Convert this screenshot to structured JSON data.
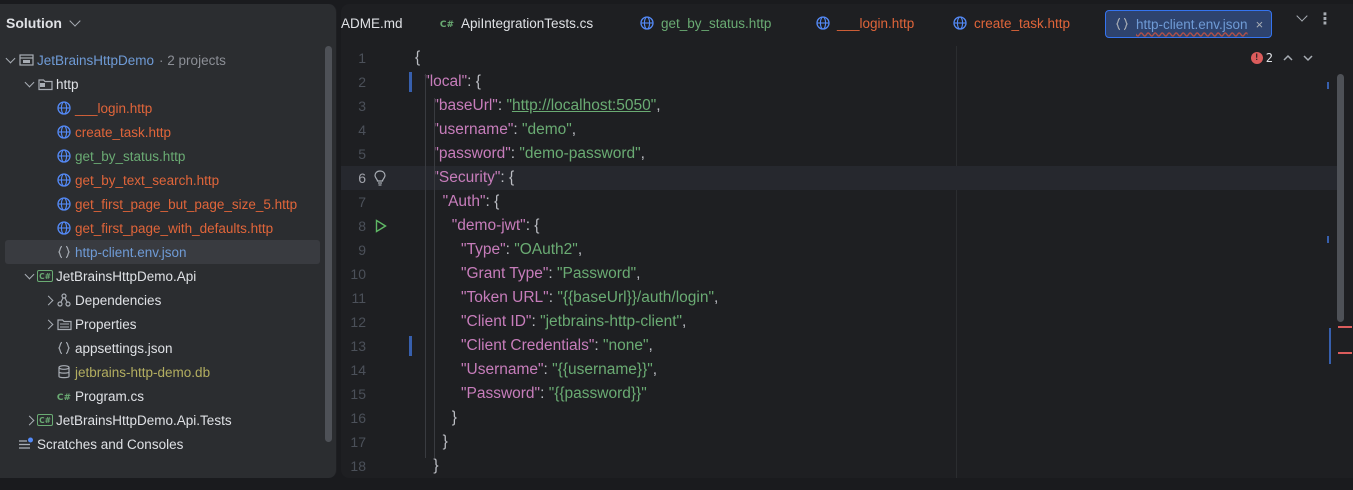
{
  "solution_panel": {
    "title": "Solution",
    "tree": [
      {
        "label": "JetBrainsHttpDemo",
        "suffix": "· 2 projects",
        "icon": "solution-icon",
        "color": "c-blue",
        "indent": 0,
        "arrow": "down"
      },
      {
        "label": "http",
        "icon": "folder-icon",
        "color": "c-white",
        "indent": 1,
        "arrow": "down"
      },
      {
        "label": "___login.http",
        "icon": "globe-icon",
        "color": "c-red",
        "indent": 2,
        "arrow": ""
      },
      {
        "label": "create_task.http",
        "icon": "globe-icon",
        "color": "c-red",
        "indent": 2,
        "arrow": ""
      },
      {
        "label": "get_by_status.http",
        "icon": "globe-icon",
        "color": "c-green",
        "indent": 2,
        "arrow": ""
      },
      {
        "label": "get_by_text_search.http",
        "icon": "globe-icon",
        "color": "c-red",
        "indent": 2,
        "arrow": ""
      },
      {
        "label": "get_first_page_but_page_size_5.http",
        "icon": "globe-icon",
        "color": "c-red",
        "indent": 2,
        "arrow": ""
      },
      {
        "label": "get_first_page_with_defaults.http",
        "icon": "globe-icon",
        "color": "c-red",
        "indent": 2,
        "arrow": ""
      },
      {
        "label": "http-client.env.json",
        "icon": "json-icon",
        "color": "c-blue",
        "indent": 2,
        "arrow": "",
        "selected": true
      },
      {
        "label": "JetBrainsHttpDemo.Api",
        "icon": "csharp-project-icon",
        "color": "c-white",
        "indent": 1,
        "arrow": "down"
      },
      {
        "label": "Dependencies",
        "icon": "dependencies-icon",
        "color": "c-white",
        "indent": 2,
        "arrow": "right"
      },
      {
        "label": "Properties",
        "icon": "properties-folder-icon",
        "color": "c-white",
        "indent": 2,
        "arrow": "right"
      },
      {
        "label": "appsettings.json",
        "icon": "json-icon",
        "color": "c-white",
        "indent": 2,
        "arrow": ""
      },
      {
        "label": "jetbrains-http-demo.db",
        "icon": "database-icon",
        "color": "c-yellow",
        "indent": 2,
        "arrow": ""
      },
      {
        "label": "Program.cs",
        "icon": "csharp-file-icon",
        "color": "c-white",
        "indent": 2,
        "arrow": ""
      },
      {
        "label": "JetBrainsHttpDemo.Api.Tests",
        "icon": "csharp-project-icon",
        "color": "c-white",
        "indent": 1,
        "arrow": "right"
      },
      {
        "label": "Scratches and Consoles",
        "icon": "scratches-icon",
        "color": "c-white",
        "indent": 0,
        "arrow": ""
      }
    ]
  },
  "tabs": [
    {
      "label": "ADME.md",
      "icon": "",
      "color": "c-white",
      "active": false
    },
    {
      "label": "ApiIntegrationTests.cs",
      "icon": "csharp-file-icon",
      "color": "c-white",
      "active": false
    },
    {
      "label": "get_by_status.http",
      "icon": "globe-icon",
      "color": "c-green",
      "active": false
    },
    {
      "label": "___login.http",
      "icon": "globe-icon",
      "color": "c-red",
      "active": false
    },
    {
      "label": "create_task.http",
      "icon": "globe-icon",
      "color": "c-red",
      "active": false
    },
    {
      "label": "http-client.env.json",
      "icon": "json-icon",
      "color": "c-blue",
      "active": true
    }
  ],
  "tab_close": "×",
  "tab_more": "⋮",
  "error_count": "2",
  "error_symbol": "!",
  "current_line": 6,
  "code_lines": [
    {
      "n": "1",
      "indent": 0,
      "tokens": [
        [
          "p",
          "{"
        ]
      ]
    },
    {
      "n": "2",
      "indent": 1,
      "tokens": [
        [
          "k",
          "\"local\""
        ],
        [
          "p",
          ": {"
        ]
      ]
    },
    {
      "n": "3",
      "indent": 2,
      "tokens": [
        [
          "k",
          "\"baseUrl\""
        ],
        [
          "p",
          ": "
        ],
        [
          "s",
          "\""
        ],
        [
          "u",
          "http://localhost:5050"
        ],
        [
          "s",
          "\""
        ],
        [
          "p",
          ","
        ]
      ]
    },
    {
      "n": "4",
      "indent": 2,
      "tokens": [
        [
          "k",
          "\"username\""
        ],
        [
          "p",
          ": "
        ],
        [
          "s",
          "\"demo\""
        ],
        [
          "p",
          ","
        ]
      ]
    },
    {
      "n": "5",
      "indent": 2,
      "tokens": [
        [
          "k",
          "\"password\""
        ],
        [
          "p",
          ": "
        ],
        [
          "s",
          "\"demo-password\""
        ],
        [
          "p",
          ","
        ]
      ]
    },
    {
      "n": "6",
      "indent": 2,
      "tokens": [
        [
          "k",
          "\"Security\""
        ],
        [
          "p",
          ": {"
        ]
      ]
    },
    {
      "n": "7",
      "indent": 3,
      "tokens": [
        [
          "k",
          "\"Auth\""
        ],
        [
          "p",
          ": {"
        ]
      ]
    },
    {
      "n": "8",
      "indent": 4,
      "tokens": [
        [
          "k",
          "\"demo-jwt\""
        ],
        [
          "p",
          ": {"
        ]
      ]
    },
    {
      "n": "9",
      "indent": 5,
      "tokens": [
        [
          "k",
          "\"Type\""
        ],
        [
          "p",
          ": "
        ],
        [
          "s",
          "\"OAuth2\""
        ],
        [
          "p",
          ","
        ]
      ]
    },
    {
      "n": "10",
      "indent": 5,
      "tokens": [
        [
          "k",
          "\"Grant Type\""
        ],
        [
          "p",
          ": "
        ],
        [
          "s",
          "\"Password\""
        ],
        [
          "p",
          ","
        ]
      ]
    },
    {
      "n": "11",
      "indent": 5,
      "tokens": [
        [
          "k",
          "\"Token URL\""
        ],
        [
          "p",
          ": "
        ],
        [
          "s",
          "\"{{baseUrl}}/auth/login\""
        ],
        [
          "p",
          ","
        ]
      ]
    },
    {
      "n": "12",
      "indent": 5,
      "tokens": [
        [
          "k",
          "\"Client ID\""
        ],
        [
          "p",
          ": "
        ],
        [
          "s",
          "\"jetbrains-http-client\""
        ],
        [
          "p",
          ","
        ]
      ]
    },
    {
      "n": "13",
      "indent": 5,
      "tokens": [
        [
          "k",
          "\"Client Credentials\""
        ],
        [
          "p",
          ": "
        ],
        [
          "s",
          "\"none\""
        ],
        [
          "p",
          ","
        ]
      ]
    },
    {
      "n": "14",
      "indent": 5,
      "tokens": [
        [
          "k",
          "\"Username\""
        ],
        [
          "p",
          ": "
        ],
        [
          "s",
          "\"{{username}}\""
        ],
        [
          "p",
          ","
        ]
      ]
    },
    {
      "n": "15",
      "indent": 5,
      "tokens": [
        [
          "k",
          "\"Password\""
        ],
        [
          "p",
          ": "
        ],
        [
          "s",
          "\"{{password}}\""
        ]
      ]
    },
    {
      "n": "16",
      "indent": 4,
      "tokens": [
        [
          "p",
          "}"
        ]
      ]
    },
    {
      "n": "17",
      "indent": 3,
      "tokens": [
        [
          "p",
          "}"
        ]
      ]
    },
    {
      "n": "18",
      "indent": 2,
      "tokens": [
        [
          "p",
          "}"
        ]
      ]
    }
  ],
  "colors": {
    "accent": "#3574f0",
    "keyword": "#c77dbb",
    "string": "#6aab73",
    "error": "#db5c5c",
    "modified_red": "#e0653a"
  }
}
